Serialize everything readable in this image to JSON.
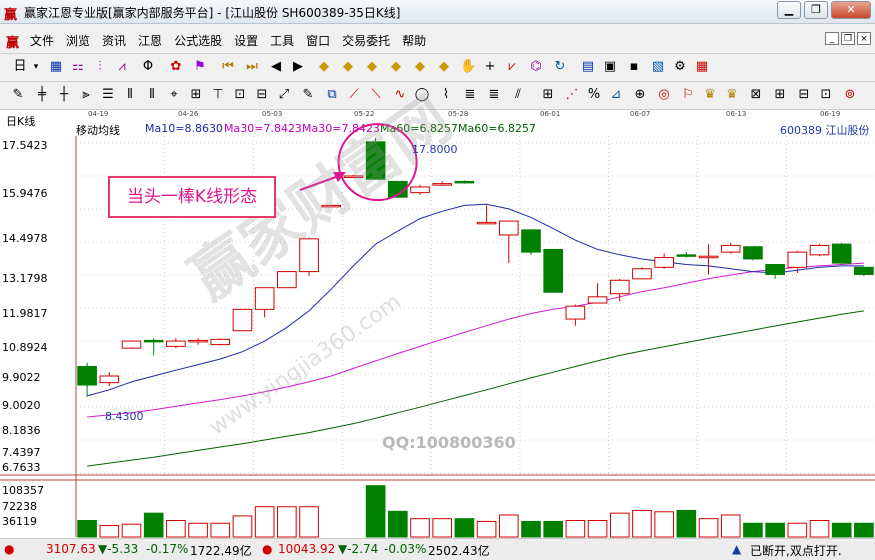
{
  "window": {
    "title": "赢家江恩专业版[赢家内部服务平台] - [江山股份   SH600389-35日K线]",
    "logo": "赢"
  },
  "menu": [
    "文件",
    "浏览",
    "资讯",
    "江恩",
    "公式选股",
    "设置",
    "工具",
    "窗口",
    "交易委托",
    "帮助"
  ],
  "toolbar_icons_1": [
    "day-icon",
    "dropdown-icon",
    "grid-icon",
    "chart-icon",
    "bars-icon",
    "zoom-icon",
    "fav-icon",
    "first-icon",
    "prev-icon",
    "back-icon",
    "next-icon",
    "diamond-icons",
    "hand-icon",
    "cross-icon",
    "draw-icon",
    "calendar-icon",
    "print-icon",
    "save-icon"
  ],
  "toolbar_icons_2": [
    "line-tools"
  ],
  "dates": [
    "04-19",
    "04-26",
    "05-03",
    "05-22",
    "05-28",
    "06-01",
    "06-07",
    "06-13",
    "06-19"
  ],
  "panel": {
    "title": "日K线"
  },
  "info": {
    "label": "移动均线",
    "ma10": "Ma10=8.8630",
    "ma30a": "Ma30=7.8423",
    "ma30b": "Ma30=7.8423",
    "ma60a": "Ma60=6.8257",
    "ma60b": "Ma60=6.8257",
    "stock": "600389  江山股份"
  },
  "y_axis": [
    "17.5423",
    "15.9476",
    "14.4978",
    "13.1798",
    "11.9817",
    "10.8924",
    "9.9022",
    "9.0020",
    "8.1836",
    "7.4397",
    "6.7633"
  ],
  "volume_axis": [
    "108357",
    "72238",
    "36119"
  ],
  "annotation": {
    "text": "当头一棒K线形态",
    "peak_value": "17.8000",
    "low_value": "8.4300"
  },
  "watermark": {
    "main": "赢家财富网",
    "site": "www.yingjia360.com",
    "qq": "QQ:100800360"
  },
  "status": {
    "sh_index": "3107.63",
    "sh_change": "▼-5.33",
    "sh_pct": "-0.17%",
    "sh_amount": "1722.49亿",
    "sz_index": "10043.92",
    "sz_change": "▼-2.74",
    "sz_pct": "-0.03%",
    "sz_amount": "2502.43亿",
    "conn": "已断开,双点打开."
  },
  "colors": {
    "up": "#d00000",
    "down": "#008000",
    "ma10": "#1f2aa6",
    "ma30": "#d01bd0",
    "ma60": "#006400"
  },
  "chart_data": {
    "type": "candlestick",
    "y_ticks": [
      17.5423,
      15.9476,
      14.4978,
      13.1798,
      11.9817,
      10.8924,
      9.9022,
      9.002,
      8.1836,
      7.4397,
      6.7633
    ],
    "candles": [
      {
        "o": 9.2,
        "h": 9.3,
        "l": 8.43,
        "c": 8.72
      },
      {
        "o": 8.78,
        "h": 9.05,
        "l": 8.7,
        "c": 8.95
      },
      {
        "o": 9.7,
        "h": 9.92,
        "l": 9.68,
        "c": 9.9
      },
      {
        "o": 9.92,
        "h": 9.98,
        "l": 9.5,
        "c": 9.9
      },
      {
        "o": 9.75,
        "h": 9.98,
        "l": 9.7,
        "c": 9.9
      },
      {
        "o": 9.88,
        "h": 9.98,
        "l": 9.8,
        "c": 9.92
      },
      {
        "o": 9.8,
        "h": 9.98,
        "l": 9.78,
        "c": 9.95
      },
      {
        "o": 10.2,
        "h": 10.85,
        "l": 10.2,
        "c": 10.85
      },
      {
        "o": 10.85,
        "h": 11.55,
        "l": 10.6,
        "c": 11.55
      },
      {
        "o": 11.55,
        "h": 12.1,
        "l": 11.55,
        "c": 12.1
      },
      {
        "o": 12.1,
        "h": 13.35,
        "l": 11.95,
        "c": 13.3
      },
      {
        "o": 14.6,
        "h": 14.65,
        "l": 14.6,
        "c": 14.65
      },
      {
        "o": 15.95,
        "h": 16.0,
        "l": 15.9,
        "c": 15.95
      },
      {
        "o": 17.6,
        "h": 17.8,
        "l": 15.8,
        "c": 15.8
      },
      {
        "o": 15.7,
        "h": 15.7,
        "l": 15.0,
        "c": 15.0
      },
      {
        "o": 15.2,
        "h": 15.55,
        "l": 15.1,
        "c": 15.45
      },
      {
        "o": 15.55,
        "h": 15.7,
        "l": 15.5,
        "c": 15.6
      },
      {
        "o": 15.7,
        "h": 15.75,
        "l": 15.6,
        "c": 15.65
      },
      {
        "o": 13.95,
        "h": 14.65,
        "l": 13.9,
        "c": 13.95
      },
      {
        "o": 13.45,
        "h": 14.0,
        "l": 12.4,
        "c": 14.0
      },
      {
        "o": 13.65,
        "h": 13.65,
        "l": 12.7,
        "c": 12.8
      },
      {
        "o": 12.9,
        "h": 12.9,
        "l": 11.4,
        "c": 11.4
      },
      {
        "o": 10.55,
        "h": 11.0,
        "l": 10.35,
        "c": 10.95
      },
      {
        "o": 11.05,
        "h": 11.7,
        "l": 11.05,
        "c": 11.25
      },
      {
        "o": 11.35,
        "h": 11.85,
        "l": 11.1,
        "c": 11.8
      },
      {
        "o": 11.85,
        "h": 12.25,
        "l": 11.85,
        "c": 12.2
      },
      {
        "o": 12.25,
        "h": 12.75,
        "l": 12.2,
        "c": 12.6
      },
      {
        "o": 12.7,
        "h": 12.8,
        "l": 12.6,
        "c": 12.65
      },
      {
        "o": 12.6,
        "h": 13.1,
        "l": 12.0,
        "c": 12.65
      },
      {
        "o": 12.8,
        "h": 13.15,
        "l": 12.75,
        "c": 13.05
      },
      {
        "o": 13.0,
        "h": 13.0,
        "l": 12.5,
        "c": 12.55
      },
      {
        "o": 12.35,
        "h": 12.35,
        "l": 11.85,
        "c": 12.0
      },
      {
        "o": 12.25,
        "h": 12.85,
        "l": 12.05,
        "c": 12.8
      },
      {
        "o": 12.7,
        "h": 13.1,
        "l": 12.65,
        "c": 13.05
      },
      {
        "o": 13.1,
        "h": 13.15,
        "l": 12.35,
        "c": 12.4
      },
      {
        "o": 12.25,
        "h": 12.25,
        "l": 11.95,
        "c": 12.0
      }
    ],
    "ma10": [
      8.45,
      8.6,
      8.8,
      8.95,
      9.1,
      9.25,
      9.4,
      9.6,
      9.9,
      10.3,
      10.8,
      11.5,
      12.3,
      13.1,
      13.6,
      14.1,
      14.4,
      14.65,
      14.7,
      14.5,
      14.15,
      13.7,
      13.25,
      12.9,
      12.7,
      12.55,
      12.45,
      12.35,
      12.3,
      12.2,
      12.1,
      12.05,
      12.15,
      12.25,
      12.3,
      12.3
    ],
    "ma30": [
      7.95,
      8.0,
      8.05,
      8.12,
      8.2,
      8.28,
      8.36,
      8.45,
      8.55,
      8.67,
      8.8,
      8.95,
      9.15,
      9.35,
      9.55,
      9.75,
      9.95,
      10.15,
      10.35,
      10.55,
      10.72,
      10.85,
      10.95,
      11.08,
      11.25,
      11.42,
      11.55,
      11.7,
      11.85,
      11.98,
      12.1,
      12.18,
      12.25,
      12.3,
      12.35,
      12.4
    ],
    "ma60": [
      6.9,
      6.96,
      7.02,
      7.08,
      7.15,
      7.22,
      7.29,
      7.36,
      7.44,
      7.52,
      7.6,
      7.7,
      7.8,
      7.92,
      8.05,
      8.18,
      8.32,
      8.46,
      8.6,
      8.75,
      8.9,
      9.05,
      9.2,
      9.35,
      9.5,
      9.62,
      9.74,
      9.86,
      9.98,
      10.1,
      10.22,
      10.34,
      10.46,
      10.58,
      10.7,
      10.8
    ],
    "volume": [
      36000,
      25000,
      28000,
      52000,
      36000,
      30000,
      30000,
      46000,
      66000,
      66000,
      66000,
      0,
      0,
      112000,
      56000,
      40000,
      40000,
      40000,
      34000,
      48000,
      34000,
      34000,
      36000,
      36000,
      52000,
      58000,
      55000,
      58000,
      40000,
      48000,
      30000,
      30000,
      30000,
      36000,
      30000,
      30000
    ]
  }
}
